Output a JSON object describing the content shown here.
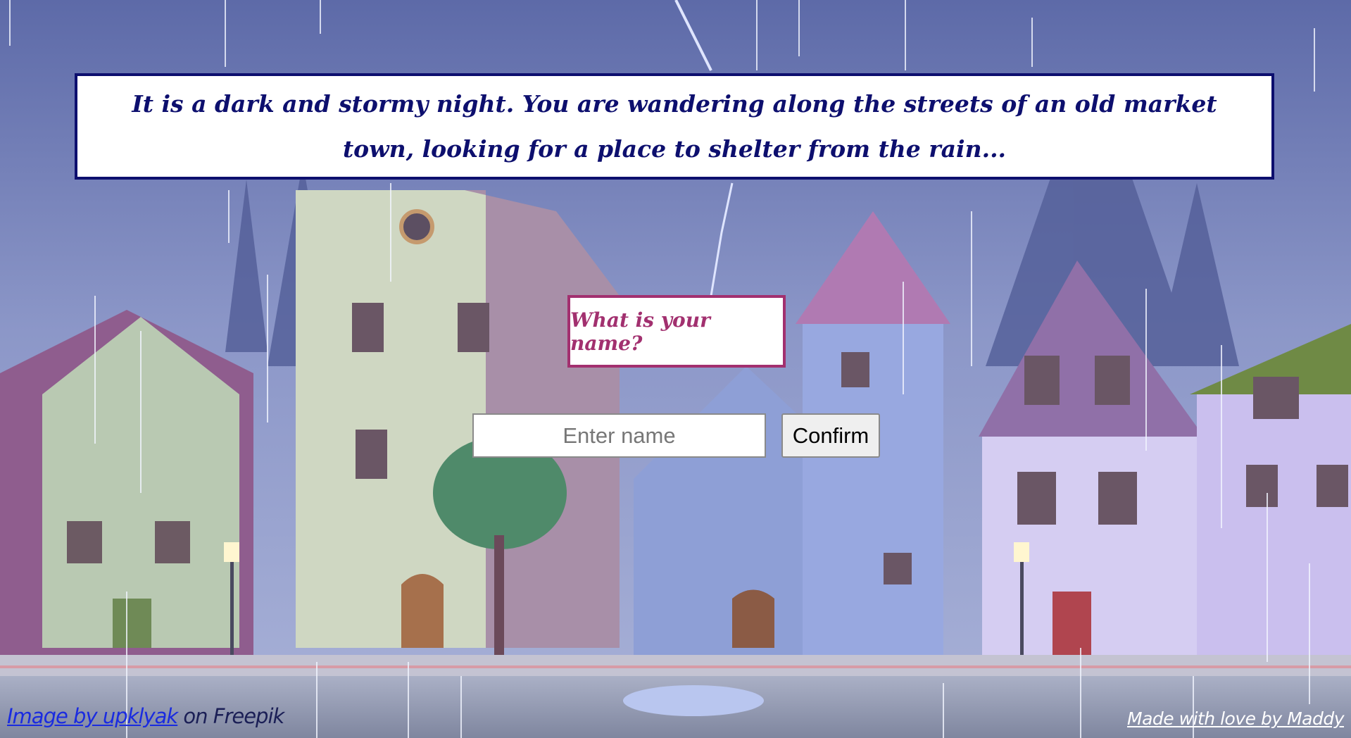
{
  "story": {
    "text": "It is a dark and stormy night. You are wandering along the streets of an old market town, looking for a place to shelter from the rain..."
  },
  "prompt": {
    "question": "What is your name?"
  },
  "form": {
    "name_placeholder": "Enter name",
    "name_value": "",
    "confirm_label": "Confirm"
  },
  "footer": {
    "credit_link_text": "Image by upklyak",
    "credit_suffix": " on Freepik",
    "signature": "Made with love by Maddy"
  },
  "colors": {
    "story_border": "#0d0f6e",
    "story_text": "#0d0f6e",
    "question_border": "#a2306f",
    "question_text": "#a2306f",
    "link": "#1a2be0"
  },
  "icons": {
    "background": "rainy-town-illustration"
  }
}
